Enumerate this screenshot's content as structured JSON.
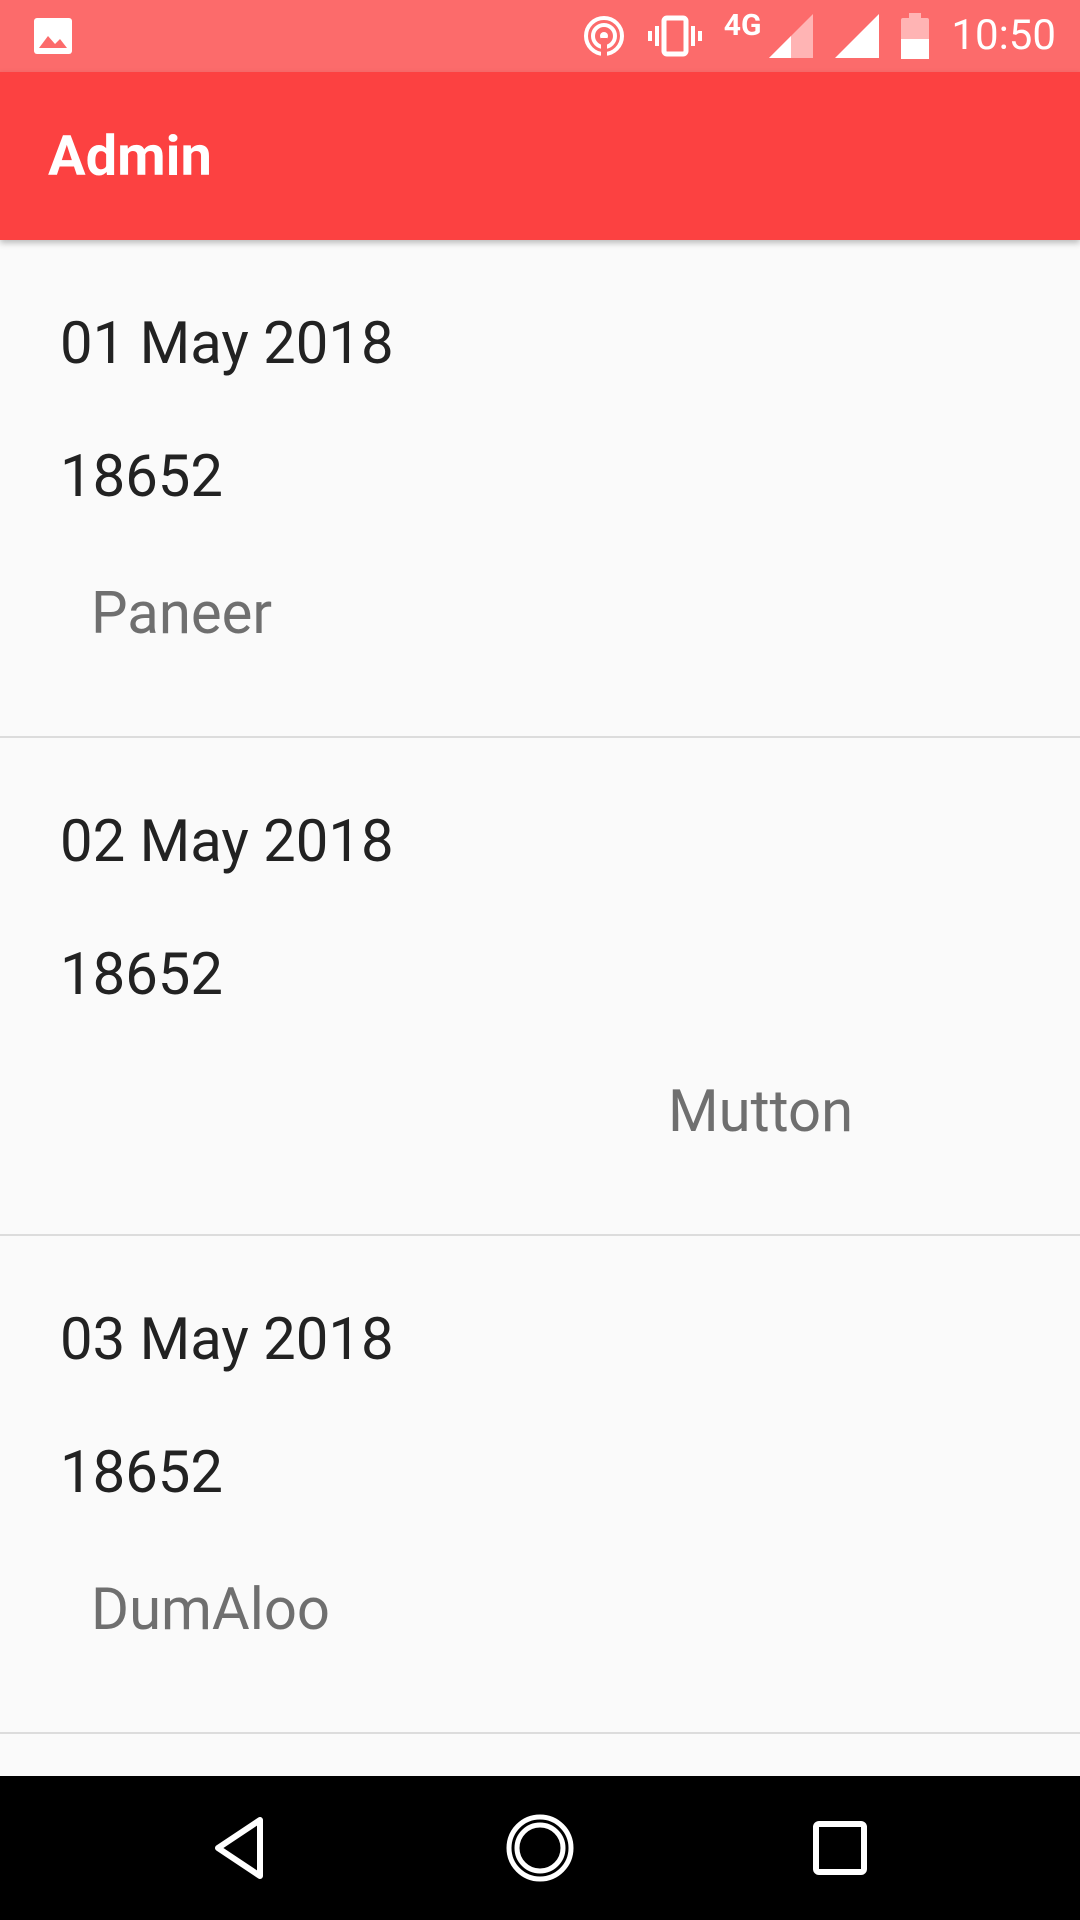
{
  "status_bar": {
    "network": "4G",
    "time": "10:50",
    "icons": [
      "image-icon",
      "hotspot-icon",
      "vibrate-icon",
      "signal-icon",
      "battery-icon"
    ]
  },
  "app_bar": {
    "title": "Admin",
    "color": "#fc4141"
  },
  "orders": [
    {
      "date": "01 May 2018",
      "id": "18652",
      "item": "Paneer"
    },
    {
      "date": "02 May 2018",
      "id": "18652",
      "item": "Mutton"
    },
    {
      "date": "03 May 2018",
      "id": "18652",
      "item": "DumAloo"
    }
  ],
  "nav_bar": {
    "buttons": [
      "back-icon",
      "home-icon",
      "recents-icon"
    ]
  }
}
